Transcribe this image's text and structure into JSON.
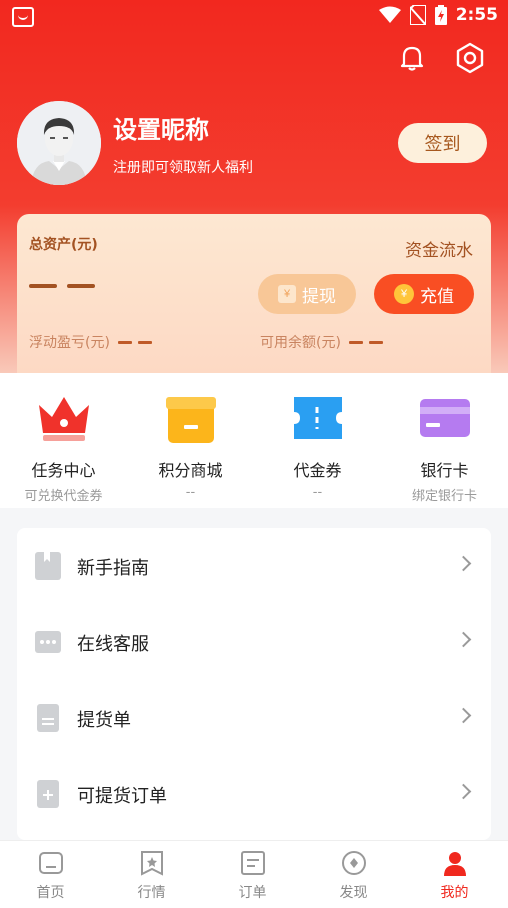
{
  "status_bar": {
    "time": "2:55"
  },
  "profile": {
    "nickname": "设置昵称",
    "subtitle": "注册即可领取新人福利",
    "signin_label": "签到"
  },
  "assets": {
    "total_label": "总资产(元)",
    "total_value": "— —",
    "flow_label": "资金流水",
    "withdraw_label": "提现",
    "recharge_label": "充值",
    "float_pl_label": "浮动盈亏(元)",
    "available_label": "可用余额(元)",
    "float_pl_value": "— —",
    "available_value": "— —"
  },
  "quick_menu": [
    {
      "title": "任务中心",
      "sub": "可兑换代金券",
      "icon": "crown-icon"
    },
    {
      "title": "积分商城",
      "sub": "--",
      "icon": "gift-icon"
    },
    {
      "title": "代金券",
      "sub": "--",
      "icon": "coupon-icon"
    },
    {
      "title": "银行卡",
      "sub": "绑定银行卡",
      "icon": "bank-card-icon"
    }
  ],
  "menu_list": [
    {
      "label": "新手指南",
      "icon": "bookmark-icon"
    },
    {
      "label": "在线客服",
      "icon": "chat-icon"
    },
    {
      "label": "提货单",
      "icon": "document-icon"
    },
    {
      "label": "可提货订单",
      "icon": "add-document-icon"
    }
  ],
  "tabbar": [
    {
      "label": "首页",
      "icon": "home-icon"
    },
    {
      "label": "行情",
      "icon": "star-flag-icon"
    },
    {
      "label": "订单",
      "icon": "order-icon"
    },
    {
      "label": "发现",
      "icon": "compass-icon"
    },
    {
      "label": "我的",
      "icon": "user-icon",
      "active": true
    }
  ],
  "colors": {
    "brand_red": "#f0281e",
    "gold_text": "#a35222",
    "recharge_orange": "#f94e23"
  }
}
